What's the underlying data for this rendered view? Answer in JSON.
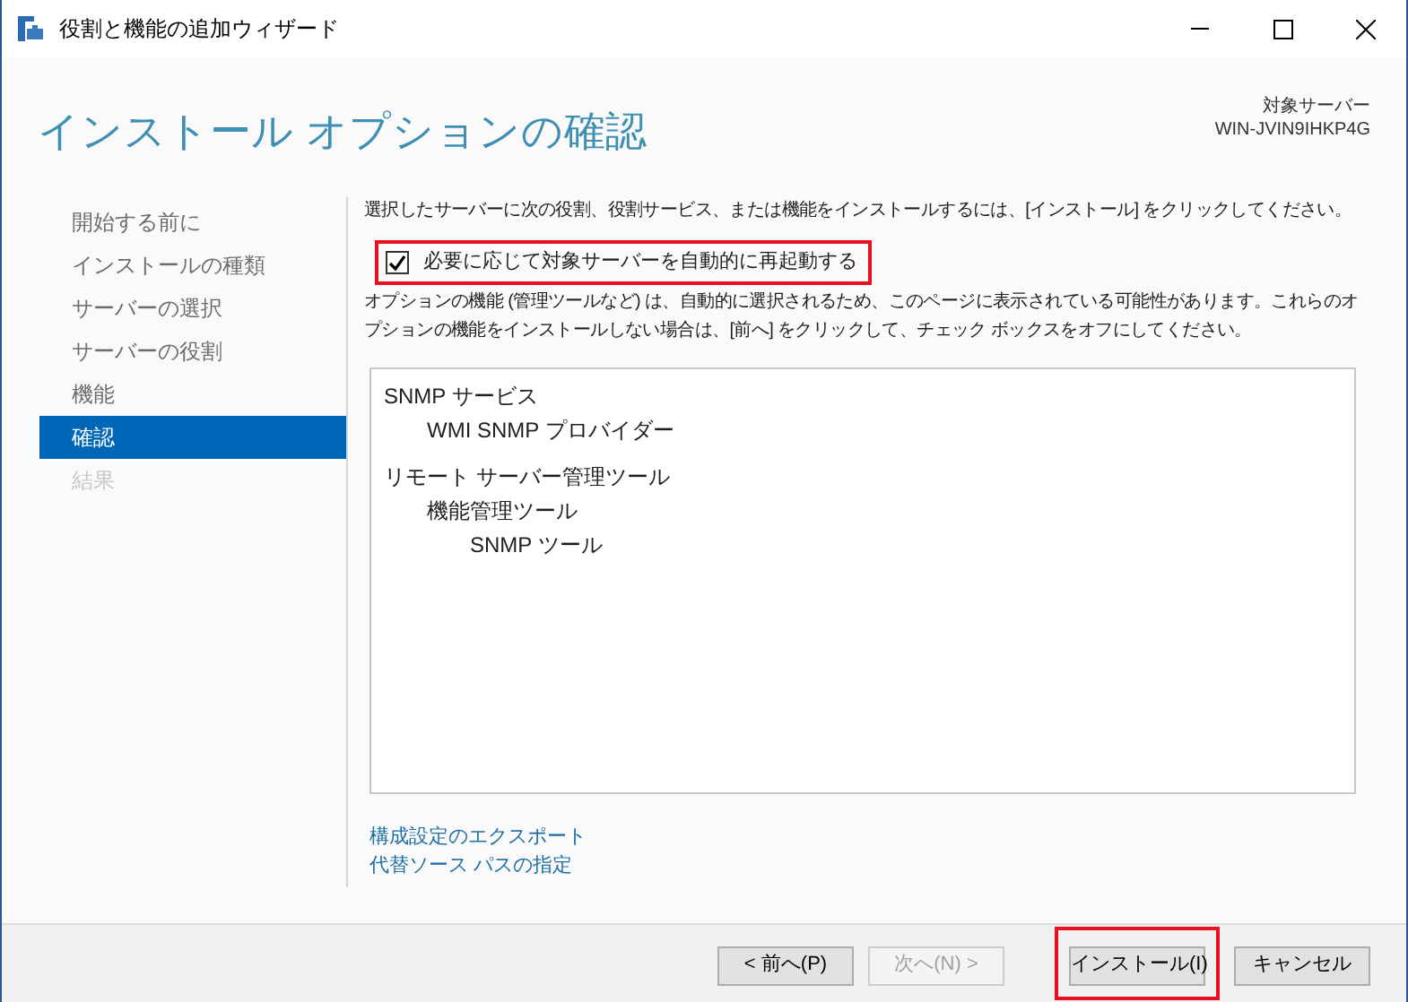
{
  "window": {
    "title": "役割と機能の追加ウィザード"
  },
  "header": {
    "title": "インストール オプションの確認",
    "target_label": "対象サーバー",
    "target_server": "WIN-JVIN9IHKP4G"
  },
  "sidebar": {
    "items": [
      {
        "label": "開始する前に",
        "selected": false,
        "disabled": false
      },
      {
        "label": "インストールの種類",
        "selected": false,
        "disabled": false
      },
      {
        "label": "サーバーの選択",
        "selected": false,
        "disabled": false
      },
      {
        "label": "サーバーの役割",
        "selected": false,
        "disabled": false
      },
      {
        "label": "機能",
        "selected": false,
        "disabled": false
      },
      {
        "label": "確認",
        "selected": true,
        "disabled": false
      },
      {
        "label": "結果",
        "selected": false,
        "disabled": true
      }
    ]
  },
  "content": {
    "intro": "選択したサーバーに次の役割、役割サービス、または機能をインストールするには、[インストール] をクリックしてください。",
    "restart_checkbox": {
      "label": "必要に応じて対象サーバーを自動的に再起動する",
      "checked": true,
      "highlighted": true
    },
    "note": "オプションの機能 (管理ツールなど) は、自動的に選択されるため、このページに表示されている可能性があります。これらのオプションの機能をインストールしない場合は、[前へ] をクリックして、チェック ボックスをオフにしてください。",
    "features": [
      {
        "label": "SNMP サービス",
        "children": [
          {
            "label": "WMI SNMP プロバイダー"
          }
        ]
      },
      {
        "label": "リモート サーバー管理ツール",
        "children": [
          {
            "label": "機能管理ツール",
            "children": [
              {
                "label": "SNMP ツール"
              }
            ]
          }
        ]
      }
    ],
    "links": [
      "構成設定のエクスポート",
      "代替ソース パスの指定"
    ]
  },
  "buttons": [
    {
      "label": "< 前へ(P)",
      "disabled": false,
      "highlighted": false
    },
    {
      "label": "次へ(N) >",
      "disabled": true,
      "highlighted": false
    },
    {
      "label": "インストール(I)",
      "disabled": false,
      "highlighted": true
    },
    {
      "label": "キャンセル",
      "disabled": false,
      "highlighted": false
    }
  ]
}
